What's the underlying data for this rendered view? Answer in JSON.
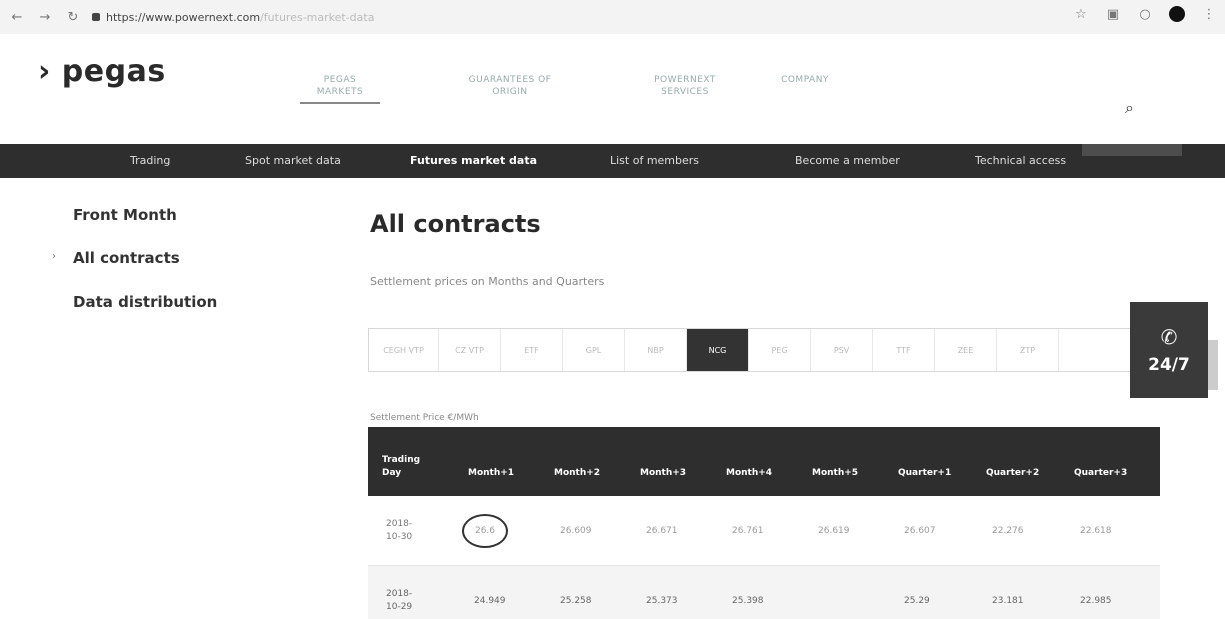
{
  "browser": {
    "url_host": "https://www.powernext.com",
    "url_path": "/futures-market-data"
  },
  "site": {
    "logo": "› pegas",
    "top_nav": [
      {
        "line1": "PEGAS",
        "line2": "MARKETS"
      },
      {
        "line1": "GUARANTEES OF",
        "line2": "ORIGIN"
      },
      {
        "line1": "POWERNEXT",
        "line2": "SERVICES"
      },
      {
        "line1": "COMPANY",
        "line2": ""
      }
    ],
    "sub_nav": [
      "Trading",
      "Spot market data",
      "Futures market data",
      "List of members",
      "Become a member",
      "Technical access"
    ]
  },
  "sidebar": {
    "items": [
      "Front Month",
      "All contracts",
      "Data distribution"
    ]
  },
  "main": {
    "title": "All contracts",
    "subtitle": "Settlement prices on Months and Quarters",
    "tabs": [
      "CEGH VTP",
      "CZ VTP",
      "ETF",
      "GPL",
      "NBP",
      "NCG",
      "PEG",
      "PSV",
      "TTF",
      "ZEE",
      "ZTP"
    ],
    "active_tab": "NCG",
    "caption": "Settlement Price €/MWh",
    "support_label": "24/7"
  },
  "table": {
    "headers": [
      {
        "line1": "Trading",
        "line2": "Day"
      },
      {
        "line1": "",
        "line2": "Month+1"
      },
      {
        "line1": "",
        "line2": "Month+2"
      },
      {
        "line1": "",
        "line2": "Month+3"
      },
      {
        "line1": "",
        "line2": "Month+4"
      },
      {
        "line1": "",
        "line2": "Month+5"
      },
      {
        "line1": "",
        "line2": "Quarter+1"
      },
      {
        "line1": "",
        "line2": "Quarter+2"
      },
      {
        "line1": "",
        "line2": "Quarter+3"
      }
    ],
    "rows": [
      {
        "day1": "2018-",
        "day2": "10-30",
        "cells": [
          "26.6",
          "26.609",
          "26.671",
          "26.761",
          "26.619",
          "26.607",
          "22.276",
          "22.618"
        ]
      },
      {
        "day1": "2018-",
        "day2": "10-29",
        "cells": [
          "24.949",
          "25.258",
          "25.373",
          "25.398",
          "",
          "25.29",
          "23.181",
          "22.985"
        ]
      }
    ]
  }
}
